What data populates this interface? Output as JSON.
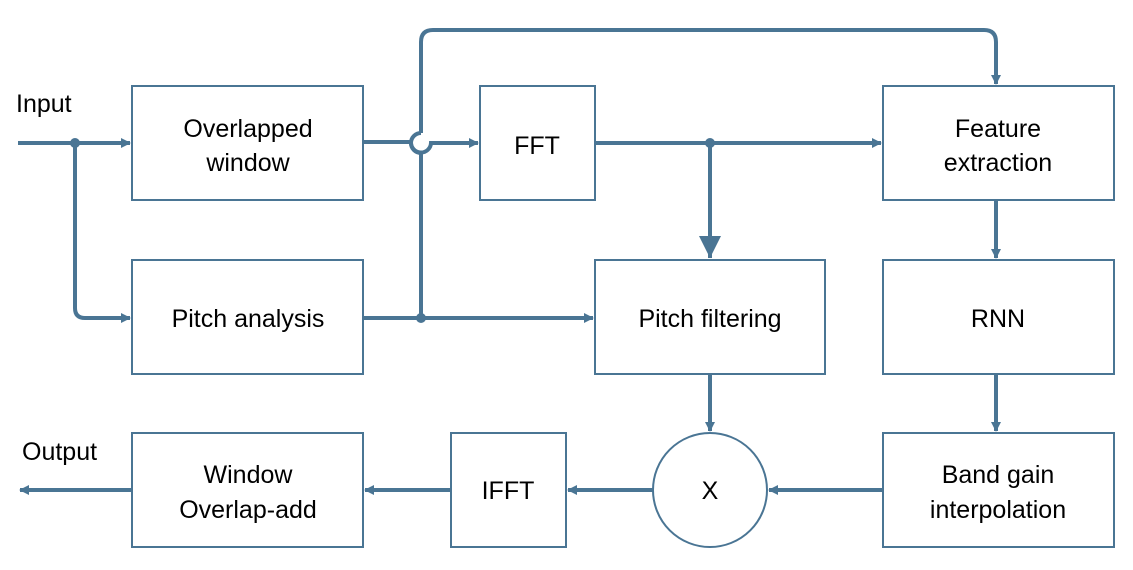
{
  "colors": {
    "stroke": "#4a7594"
  },
  "labels": {
    "input": "Input",
    "output": "Output"
  },
  "blocks": {
    "overlapped_window": [
      "Overlapped",
      "window"
    ],
    "pitch_analysis": "Pitch analysis",
    "fft": "FFT",
    "pitch_filtering": "Pitch filtering",
    "feature_extraction": [
      "Feature",
      "extraction"
    ],
    "rnn": "RNN",
    "band_gain": [
      "Band gain",
      "interpolation"
    ],
    "multiply": "X",
    "ifft": "IFFT",
    "window_overlap_add": [
      "Window",
      "Overlap-add"
    ]
  }
}
